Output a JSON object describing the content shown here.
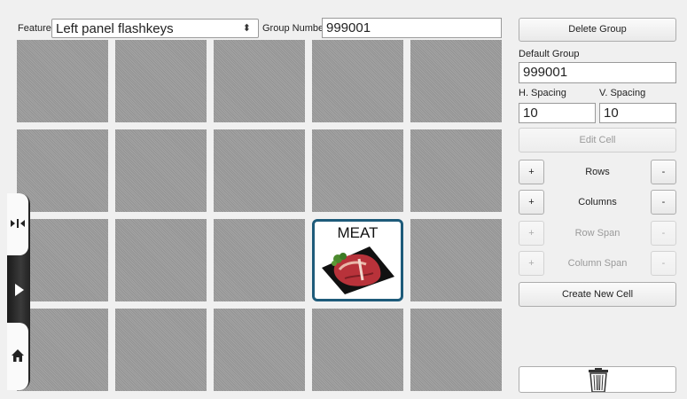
{
  "feature": {
    "label": "Feature",
    "value": "Left panel flashkeys"
  },
  "group_number": {
    "label": "Group Number",
    "value": "999001"
  },
  "grid": {
    "rows": 4,
    "columns": 5,
    "cell_label": "MEAT",
    "cell_row": 3,
    "cell_column": 4
  },
  "panel": {
    "delete_group": "Delete Group",
    "default_group_label": "Default Group",
    "default_group_value": "999001",
    "h_spacing_label": "H. Spacing",
    "v_spacing_label": "V. Spacing",
    "h_spacing_value": "10",
    "v_spacing_value": "10",
    "edit_cell": "Edit Cell",
    "plus": "+",
    "minus": "-",
    "rows": "Rows",
    "columns": "Columns",
    "row_span": "Row Span",
    "column_span": "Column Span",
    "create_new_cell": "Create New Cell"
  },
  "icons": {
    "dropdown": "updown-chevron-icon",
    "trash": "trash-icon",
    "expand": "play-triangle-icon",
    "home": "home-icon",
    "snap": "split-arrows-icon"
  }
}
